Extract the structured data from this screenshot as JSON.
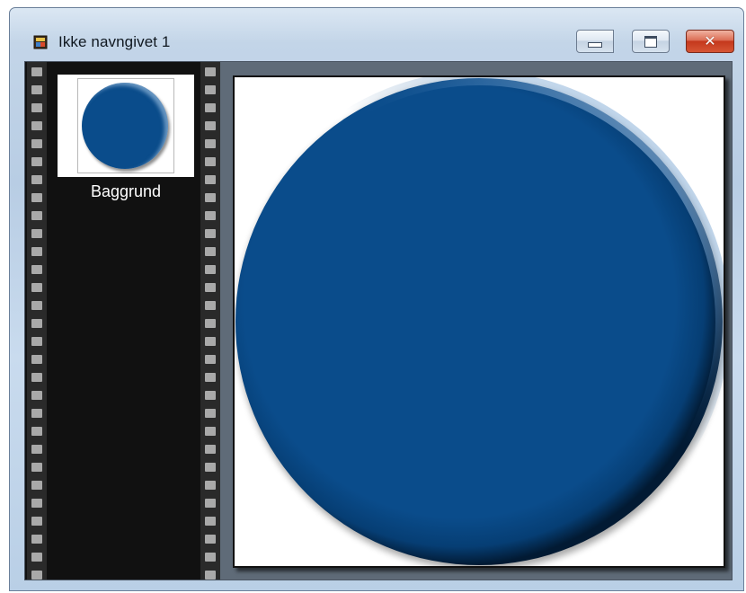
{
  "window": {
    "title": "Ikke navngivet 1"
  },
  "caption_buttons": {
    "minimize_icon": "minimize-icon",
    "maximize_icon": "maximize-icon",
    "close_icon": "close-icon",
    "close_glyph": "✕"
  },
  "layers": {
    "items": [
      {
        "label": "Baggrund",
        "thumbnail": "blue-circle"
      }
    ]
  },
  "canvas": {
    "shape": "circle",
    "fill_color": "#0a4c8b",
    "background_color": "#ffffff"
  },
  "colors": {
    "filmstrip": "#111111",
    "workspace": "#5f6b78",
    "circle_blue": "#0a4c8b",
    "close_red": "#c4381c"
  }
}
